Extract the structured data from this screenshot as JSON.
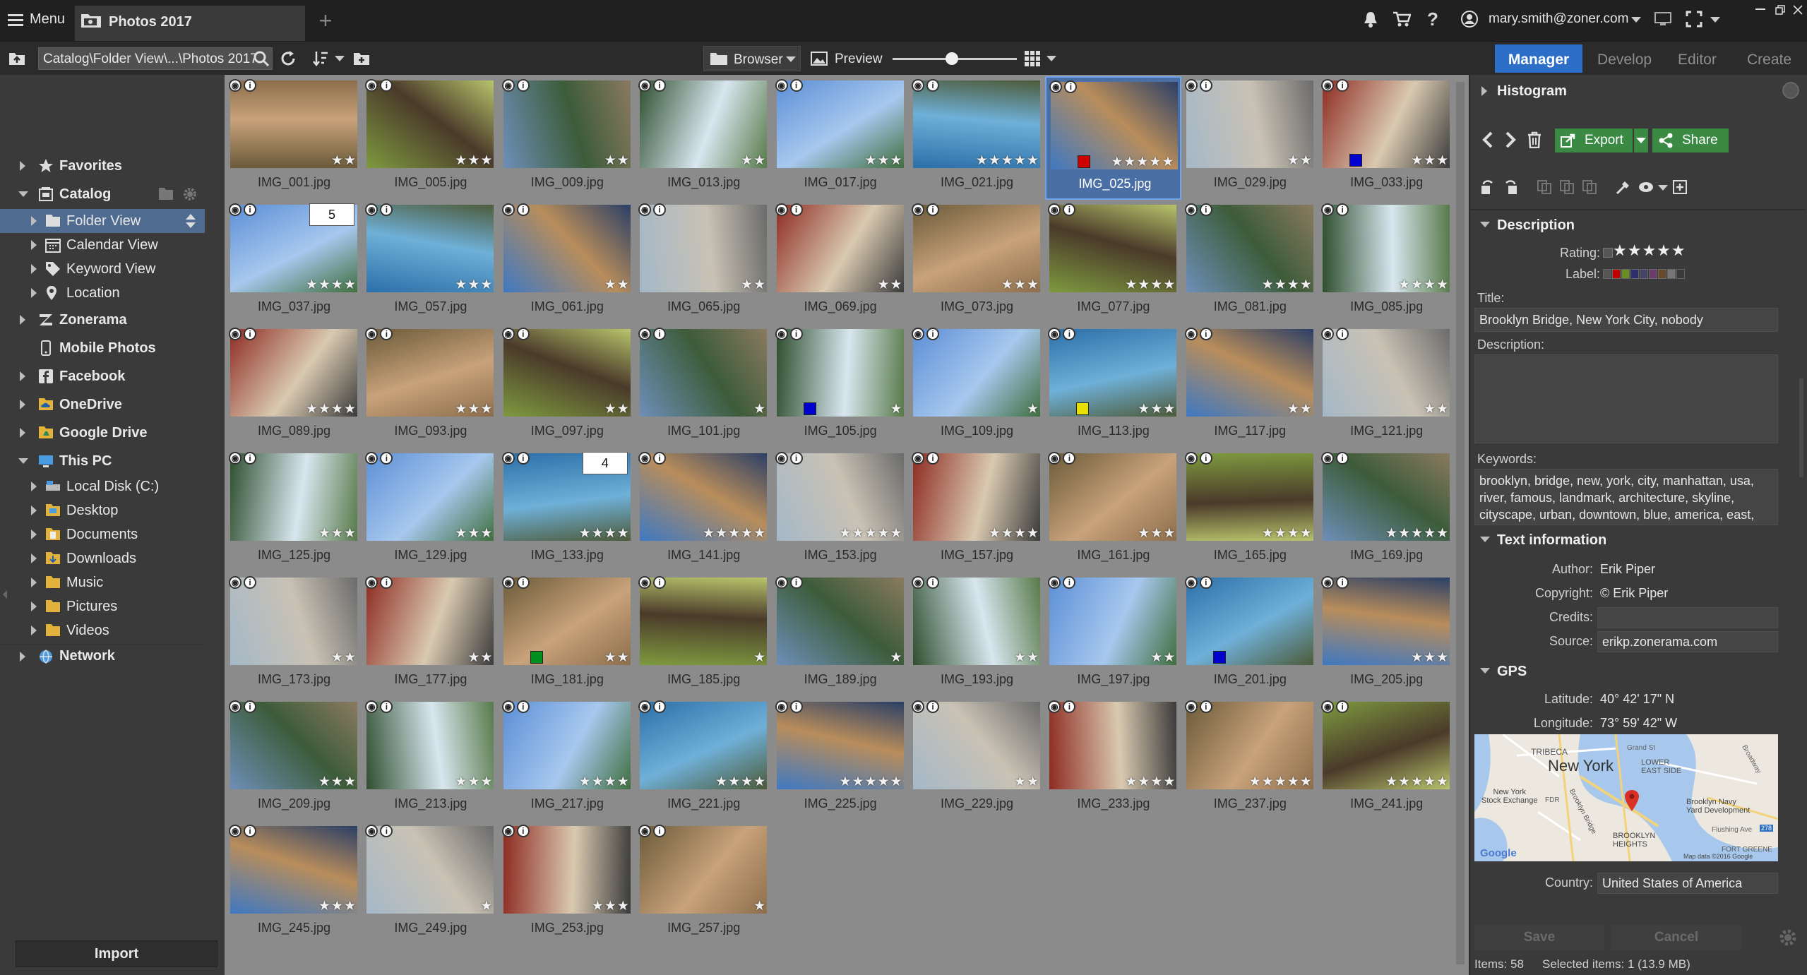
{
  "titlebar": {
    "menu_label": "Menu",
    "tab_title": "Photos 2017",
    "user_email": "mary.smith@zoner.com"
  },
  "toolbar": {
    "path": "Catalog\\Folder View\\...\\Photos 2017",
    "browser_label": "Browser",
    "preview_label": "Preview",
    "thumb_size_percent": 48
  },
  "modules": {
    "manager": "Manager",
    "develop": "Develop",
    "editor": "Editor",
    "create": "Create"
  },
  "sidebar": {
    "favorites": "Favorites",
    "catalog": "Catalog",
    "folder_view": "Folder View",
    "calendar_view": "Calendar View",
    "keyword_view": "Keyword View",
    "location": "Location",
    "zonerama": "Zonerama",
    "mobile_photos": "Mobile Photos",
    "facebook": "Facebook",
    "onedrive": "OneDrive",
    "google_drive": "Google Drive",
    "this_pc": "This PC",
    "local_disk": "Local Disk (C:)",
    "desktop": "Desktop",
    "documents": "Documents",
    "downloads": "Downloads",
    "music": "Music",
    "pictures": "Pictures",
    "videos": "Videos",
    "network": "Network",
    "import_label": "Import"
  },
  "photos": [
    {
      "name": "IMG_001.jpg",
      "stars": 2
    },
    {
      "name": "IMG_005.jpg",
      "stars": 3
    },
    {
      "name": "IMG_009.jpg",
      "stars": 2
    },
    {
      "name": "IMG_013.jpg",
      "stars": 2
    },
    {
      "name": "IMG_017.jpg",
      "stars": 3
    },
    {
      "name": "IMG_021.jpg",
      "stars": 5
    },
    {
      "name": "IMG_025.jpg",
      "stars": 5,
      "selected": true,
      "label": "#d00000"
    },
    {
      "name": "IMG_029.jpg",
      "stars": 2
    },
    {
      "name": "IMG_033.jpg",
      "stars": 3,
      "label": "#0000d0"
    },
    {
      "name": "IMG_037.jpg",
      "stars": 4,
      "stack": "5"
    },
    {
      "name": "IMG_057.jpg",
      "stars": 3
    },
    {
      "name": "IMG_061.jpg",
      "stars": 2
    },
    {
      "name": "IMG_065.jpg",
      "stars": 2
    },
    {
      "name": "IMG_069.jpg",
      "stars": 2
    },
    {
      "name": "IMG_073.jpg",
      "stars": 3
    },
    {
      "name": "IMG_077.jpg",
      "stars": 4
    },
    {
      "name": "IMG_081.jpg",
      "stars": 4
    },
    {
      "name": "IMG_085.jpg",
      "stars": 4
    },
    {
      "name": "IMG_089.jpg",
      "stars": 4
    },
    {
      "name": "IMG_093.jpg",
      "stars": 3
    },
    {
      "name": "IMG_097.jpg",
      "stars": 2
    },
    {
      "name": "IMG_101.jpg",
      "stars": 1
    },
    {
      "name": "IMG_105.jpg",
      "stars": 1,
      "label": "#0000d0"
    },
    {
      "name": "IMG_109.jpg",
      "stars": 1
    },
    {
      "name": "IMG_113.jpg",
      "stars": 3,
      "label": "#e8e000"
    },
    {
      "name": "IMG_117.jpg",
      "stars": 2
    },
    {
      "name": "IMG_121.jpg",
      "stars": 2
    },
    {
      "name": "IMG_125.jpg",
      "stars": 3
    },
    {
      "name": "IMG_129.jpg",
      "stars": 3
    },
    {
      "name": "IMG_133.jpg",
      "stars": 4,
      "stack": "4"
    },
    {
      "name": "IMG_141.jpg",
      "stars": 5
    },
    {
      "name": "IMG_153.jpg",
      "stars": 5
    },
    {
      "name": "IMG_157.jpg",
      "stars": 4
    },
    {
      "name": "IMG_161.jpg",
      "stars": 3
    },
    {
      "name": "IMG_165.jpg",
      "stars": 4
    },
    {
      "name": "IMG_169.jpg",
      "stars": 5
    },
    {
      "name": "IMG_173.jpg",
      "stars": 2
    },
    {
      "name": "IMG_177.jpg",
      "stars": 2
    },
    {
      "name": "IMG_181.jpg",
      "stars": 2,
      "label": "#009020"
    },
    {
      "name": "IMG_185.jpg",
      "stars": 1
    },
    {
      "name": "IMG_189.jpg",
      "stars": 1
    },
    {
      "name": "IMG_193.jpg",
      "stars": 2
    },
    {
      "name": "IMG_197.jpg",
      "stars": 2
    },
    {
      "name": "IMG_201.jpg",
      "stars": 0,
      "label": "#0000d0"
    },
    {
      "name": "IMG_205.jpg",
      "stars": 3
    },
    {
      "name": "IMG_209.jpg",
      "stars": 3
    },
    {
      "name": "IMG_213.jpg",
      "stars": 3
    },
    {
      "name": "IMG_217.jpg",
      "stars": 4
    },
    {
      "name": "IMG_221.jpg",
      "stars": 4
    },
    {
      "name": "IMG_225.jpg",
      "stars": 5
    },
    {
      "name": "IMG_229.jpg",
      "stars": 2
    },
    {
      "name": "IMG_233.jpg",
      "stars": 4
    },
    {
      "name": "IMG_237.jpg",
      "stars": 5
    },
    {
      "name": "IMG_241.jpg",
      "stars": 5
    },
    {
      "name": "IMG_245.jpg",
      "stars": 3
    },
    {
      "name": "IMG_249.jpg",
      "stars": 1
    },
    {
      "name": "IMG_253.jpg",
      "stars": 3
    },
    {
      "name": "IMG_257.jpg",
      "stars": 1
    }
  ],
  "rpanel": {
    "histogram": "Histogram",
    "export_label": "Export",
    "share_label": "Share",
    "description_head": "Description",
    "rating_label": "Rating:",
    "rating_stars": "★★★★★",
    "label_label": "Label:",
    "title_label": "Title:",
    "title_value": "Brooklyn Bridge, New York City, nobody",
    "description_label": "Description:",
    "keywords_label": "Keywords:",
    "keywords_value": "brooklyn, bridge, new, york, city, manhattan, usa, river, famous, landmark, architecture, skyline, cityscape, urban, downtown, blue, america, east,",
    "text_info_head": "Text information",
    "author_label": "Author:",
    "author_value": "Erik Piper",
    "copyright_label": "Copyright:",
    "copyright_value": "© Erik Piper",
    "credits_label": "Credits:",
    "source_label": "Source:",
    "source_value": "erikp.zonerama.com",
    "gps_head": "GPS",
    "latitude_label": "Latitude:",
    "latitude_value": "40° 42' 17\" N",
    "longitude_label": "Longitude:",
    "longitude_value": "73° 59' 42\" W",
    "country_label": "Country:",
    "country_value": "United States of America",
    "save_label": "Save",
    "cancel_label": "Cancel",
    "map": {
      "city": "New York",
      "tribeca": "TRIBECA",
      "lower_east_side": "LOWER\nEAST SIDE",
      "stock_exchange": "New York\nStock Exchange",
      "navy_yard": "Brooklyn Navy\nYard Development",
      "brooklyn_heights": "BROOKLYN\nHEIGHTS",
      "fort_greene": "FORT GREENE",
      "google": "Google",
      "attribution": "Map data ©2016 Google",
      "bridge": "Brooklyn Bridge",
      "fdr": "FDR",
      "flushing": "Flushing Ave",
      "route": "278",
      "broadway": "Broadway",
      "grand_st": "Grand St"
    }
  },
  "status": {
    "items": "Items: 58",
    "selected": "Selected items: 1 (13.9 MB)"
  },
  "label_colors": [
    "#555555",
    "#c00000",
    "#6b8e23",
    "#2f2f6f",
    "#444466",
    "#6a3d6a",
    "#6b4a2b",
    "#777777",
    "#3a3a3a"
  ],
  "colors": {
    "accent": "#2d6fc8",
    "green": "#3a8a44",
    "grid_bg": "#8b8b8b"
  }
}
